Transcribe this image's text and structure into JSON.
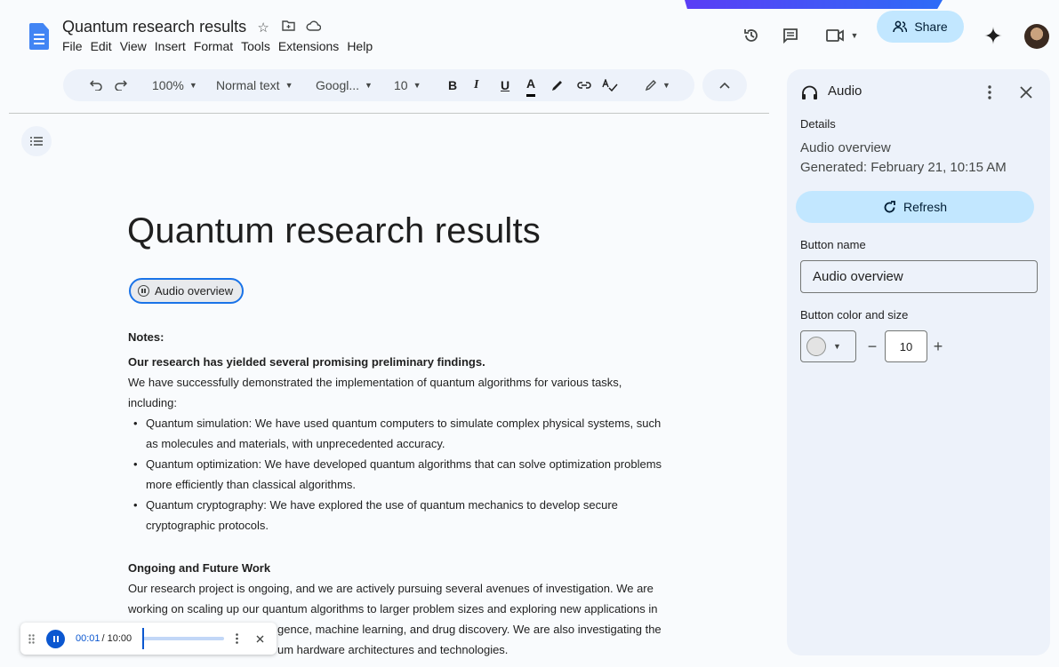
{
  "document": {
    "title": "Quantum research results",
    "menu": [
      "File",
      "Edit",
      "View",
      "Insert",
      "Format",
      "Tools",
      "Extensions",
      "Help"
    ]
  },
  "header": {
    "share_label": "Share",
    "icons": [
      "history-icon",
      "comments-icon",
      "meet-icon",
      "gemini-icon"
    ]
  },
  "toolbar": {
    "zoom": "100%",
    "style": "Normal text",
    "font": "Googl...",
    "font_size": "10",
    "bold": "B",
    "italic": "I",
    "underline": "U",
    "text_color": "A"
  },
  "body": {
    "heading": "Quantum research results",
    "audio_chip_label": "Audio overview",
    "notes_label": "Notes:",
    "intro_bold": "Our research has yielded several promising preliminary findings.",
    "intro_line1": "We have successfully demonstrated the implementation of quantum algorithms for various tasks,",
    "intro_line2": "including:",
    "bullets": [
      "Quantum simulation: We have used quantum computers to simulate complex physical systems, such as molecules and materials, with unprecedented accuracy.",
      "Quantum optimization: We have developed quantum algorithms that can solve optimization problems more efficiently than classical algorithms.",
      "Quantum cryptography: We have explored the use of quantum mechanics to develop secure cryptographic protocols."
    ],
    "section_heading": "Ongoing and Future Work",
    "section_line1": "Our research project is ongoing, and we are actively pursuing several avenues of investigation. We are",
    "section_line2": "working on scaling up our quantum algorithms to larger problem sizes and exploring new applications in",
    "section_line3_partial": "gence, machine learning, and drug discovery. We are also investigating the",
    "section_line4_partial": "um hardware architectures and technologies."
  },
  "panel": {
    "title": "Audio",
    "details_label": "Details",
    "overview_name": "Audio overview",
    "generated": "Generated: February 21, 10:15 AM",
    "refresh_label": "Refresh",
    "button_name_label": "Button name",
    "button_name_value": "Audio overview",
    "color_size_label": "Button color and size",
    "size_value": "10",
    "minus": "−",
    "plus": "+"
  },
  "player": {
    "current": "00:01",
    "total": "/ 10:00",
    "progress_fraction": 0.002
  },
  "colors": {
    "accent": "#0b57d0",
    "share_bg": "#c2e7ff",
    "toolbar_bg": "#edf2fa"
  }
}
